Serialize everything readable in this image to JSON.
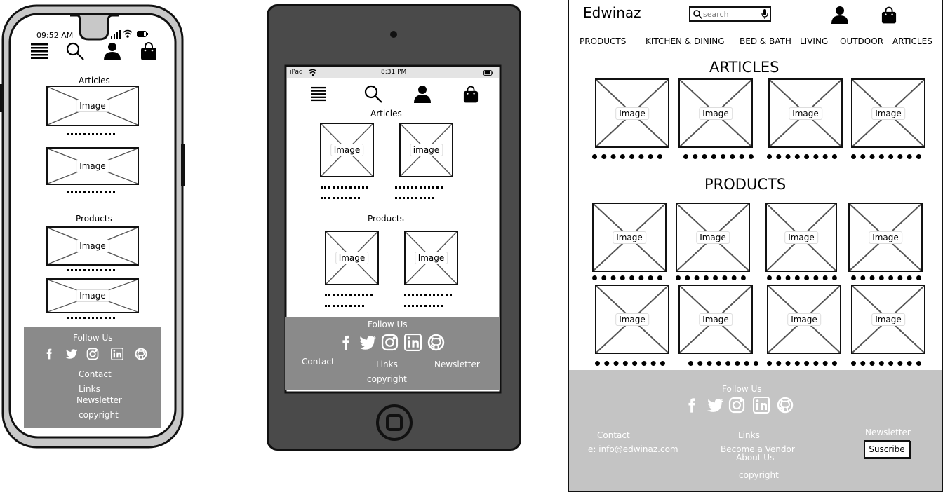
{
  "phone": {
    "time": "09:52 AM",
    "articles_heading": "Articles",
    "products_heading": "Products",
    "image_label": "Image",
    "footer": {
      "follow_us": "Follow Us",
      "contact": "Contact",
      "links": "Links",
      "newsletter": "Newsletter",
      "copyright": "copyright"
    }
  },
  "tablet": {
    "status_device": "iPad",
    "time": "8:31 PM",
    "articles_heading": "Articles",
    "products_heading": "Products",
    "image_labels": [
      "Image",
      "image",
      "Image",
      "Image"
    ],
    "footer": {
      "follow_us": "Follow Us",
      "contact": "Contact",
      "links": "Links",
      "newsletter": "Newsletter",
      "copyright": "copyright"
    }
  },
  "desktop": {
    "logo": "Edwinaz",
    "search_placeholder": "search",
    "nav": [
      "PRODUCTS",
      "KITCHEN & DINING",
      "BED & BATH",
      "LIVING",
      "OUTDOOR",
      "ARTICLES"
    ],
    "articles_heading": "ARTICLES",
    "products_heading": "PRODUCTS",
    "image_label": "Image",
    "footer": {
      "follow_us": "Follow Us",
      "contact_heading": "Contact",
      "contact_email": "e: info@edwinaz.com",
      "links_heading": "Links",
      "links_vendor": "Become a Vendor",
      "links_about": "About Us",
      "newsletter_heading": "Newsletter",
      "subscribe_button": "Suscribe",
      "copyright": "copyright"
    }
  },
  "colors": {
    "phone_body": "#c8c8c8",
    "tablet_body": "#4a4a4a",
    "footer_grey": "#8a8a8a",
    "desktop_footer": "#c4c4c4"
  },
  "icons": [
    "menu-icon",
    "search-icon",
    "user-icon",
    "bag-icon",
    "facebook-icon",
    "twitter-icon",
    "instagram-icon",
    "linkedin-icon",
    "github-icon",
    "wifi-icon",
    "signal-icon",
    "battery-icon",
    "microphone-icon",
    "home-button-icon",
    "camera-icon"
  ]
}
